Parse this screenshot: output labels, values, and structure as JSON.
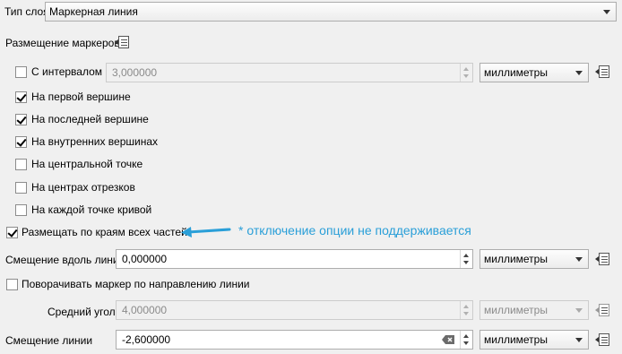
{
  "layer_type": {
    "label": "Тип слоя",
    "value": "Маркерная линия"
  },
  "placement": {
    "heading": "Размещение маркеров"
  },
  "interval": {
    "label": "С интервалом",
    "checked": false,
    "value": "3,000000",
    "unit": "миллиметры"
  },
  "options": [
    {
      "label": "На первой вершине",
      "checked": true
    },
    {
      "label": "На последней вершине",
      "checked": true
    },
    {
      "label": "На внутренних вершинах",
      "checked": true
    },
    {
      "label": "На центральной точке",
      "checked": false
    },
    {
      "label": "На центрах отрезков",
      "checked": false
    },
    {
      "label": "На каждой точке кривой",
      "checked": false
    }
  ],
  "edges": {
    "label": "Размещать по краям всех частей",
    "checked": true
  },
  "annotation": {
    "text": "* отключение опции не поддерживается",
    "color": "#2a9fd8"
  },
  "offset_along": {
    "label": "Смещение вдоль линии",
    "value": "0,000000",
    "unit": "миллиметры"
  },
  "rotate": {
    "label": "Поворачивать маркер по направлению линии",
    "checked": false
  },
  "avg_angle": {
    "label": "Средний угол",
    "value": "4,000000",
    "unit": "миллиметры"
  },
  "line_offset": {
    "label": "Смещение линии",
    "value": "-2,600000",
    "unit": "миллиметры"
  }
}
